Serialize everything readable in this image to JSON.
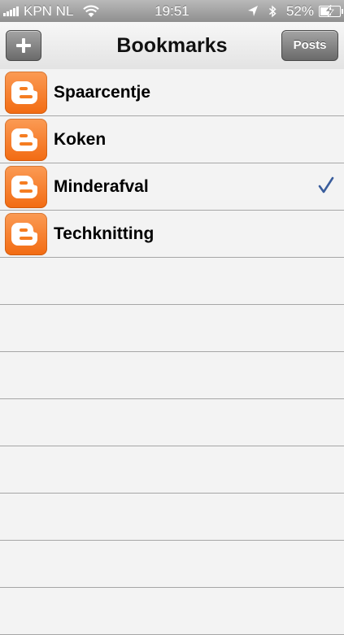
{
  "status_bar": {
    "carrier": "KPN NL",
    "time": "19:51",
    "battery_percent": "52%",
    "battery_level": 0.52,
    "icons": [
      "signal-icon",
      "wifi-icon",
      "location-icon",
      "bluetooth-icon",
      "battery-icon"
    ]
  },
  "nav": {
    "title": "Bookmarks",
    "add_label": "+",
    "posts_label": "Posts"
  },
  "bookmarks": [
    {
      "label": "Spaarcentje",
      "icon": "blogger-icon",
      "selected": false
    },
    {
      "label": "Koken",
      "icon": "blogger-icon",
      "selected": false
    },
    {
      "label": "Minderafval",
      "icon": "blogger-icon",
      "selected": true
    },
    {
      "label": "Techknitting",
      "icon": "blogger-icon",
      "selected": false
    }
  ],
  "colors": {
    "accent_check": "#3a5d9c",
    "blogger_orange": "#f57d21"
  }
}
